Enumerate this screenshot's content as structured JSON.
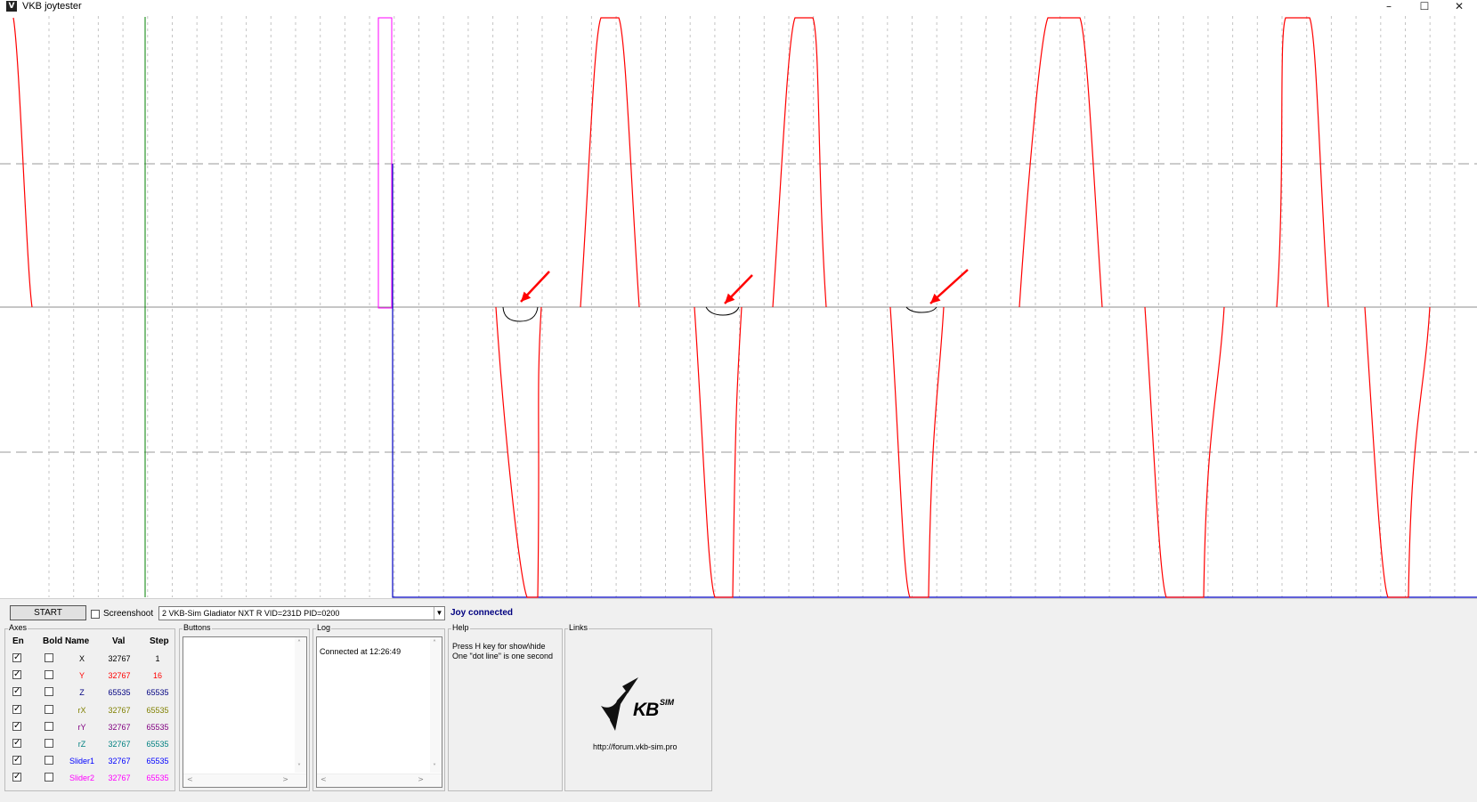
{
  "window": {
    "title": "VKB joytester",
    "minimize": "–",
    "maximize": "☐",
    "close": "✕",
    "app_icon": "V"
  },
  "colors": {
    "curve": "#ff0000",
    "x_marker": "#008000",
    "magenta_marker": "#ff00ff",
    "blue_marker": "#0000c0",
    "annotation_arrow": "#ff0000"
  },
  "toolbar": {
    "start_label": "START",
    "screenshot_label": "Screenshoot",
    "screenshot_checked": false,
    "device_selected": "2  VKB-Sim Gladiator NXT R   VID=231D PID=0200",
    "status": "Joy connected"
  },
  "axes": {
    "title": "Axes",
    "headers": {
      "en": "En",
      "bold": "Bold",
      "name": "Name",
      "val": "Val",
      "step": "Step"
    },
    "rows": [
      {
        "name": "X",
        "val": "32767",
        "step": "1",
        "color": "#000000",
        "enabled": true,
        "bold": false
      },
      {
        "name": "Y",
        "val": "32767",
        "step": "16",
        "color": "#ff0000",
        "enabled": true,
        "bold": false
      },
      {
        "name": "Z",
        "val": "65535",
        "step": "65535",
        "color": "#000080",
        "enabled": true,
        "bold": false
      },
      {
        "name": "rX",
        "val": "32767",
        "step": "65535",
        "color": "#808000",
        "enabled": true,
        "bold": false
      },
      {
        "name": "rY",
        "val": "32767",
        "step": "65535",
        "color": "#800080",
        "enabled": true,
        "bold": false
      },
      {
        "name": "rZ",
        "val": "32767",
        "step": "65535",
        "color": "#008080",
        "enabled": true,
        "bold": false
      },
      {
        "name": "Slider1",
        "val": "32767",
        "step": "65535",
        "color": "#0000ff",
        "enabled": true,
        "bold": false
      },
      {
        "name": "Slider2",
        "val": "32767",
        "step": "65535",
        "color": "#ff00ff",
        "enabled": true,
        "bold": false
      }
    ]
  },
  "buttons_group": {
    "title": "Buttons"
  },
  "log": {
    "title": "Log",
    "entries": [
      "Connected at 12:26:49"
    ]
  },
  "help": {
    "title": "Help",
    "lines": [
      "Press H key for show\\hide",
      "One \"dot line\" is one second"
    ]
  },
  "links": {
    "title": "Links",
    "logo_text": "KB",
    "logo_sub": "SIM",
    "url": "http://forum.vkb-sim.pro"
  }
}
